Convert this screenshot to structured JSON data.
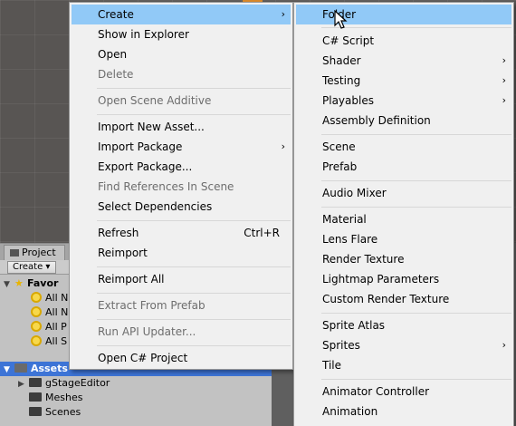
{
  "project_panel": {
    "tab_label": "Project",
    "create_label": "Create ▾",
    "favorites_label": "Favor",
    "favorite_items": [
      "All N",
      "All N",
      "All P",
      "All S"
    ],
    "assets_label": "Assets",
    "asset_folders": [
      "gStageEditor",
      "Meshes",
      "Scenes"
    ]
  },
  "context_menu": {
    "items": [
      {
        "label": "Create",
        "submenu": true,
        "highlighted": true
      },
      {
        "label": "Show in Explorer"
      },
      {
        "label": "Open"
      },
      {
        "label": "Delete",
        "disabled": true
      },
      {
        "label": "Open Scene Additive",
        "disabled": true
      },
      {
        "label": "Import New Asset..."
      },
      {
        "label": "Import Package",
        "submenu": true
      },
      {
        "label": "Export Package..."
      },
      {
        "label": "Find References In Scene",
        "disabled": true
      },
      {
        "label": "Select Dependencies"
      },
      {
        "label": "Refresh",
        "shortcut": "Ctrl+R"
      },
      {
        "label": "Reimport"
      },
      {
        "label": "Reimport All"
      },
      {
        "label": "Extract From Prefab",
        "disabled": true
      },
      {
        "label": "Run API Updater...",
        "disabled": true
      },
      {
        "label": "Open C# Project"
      }
    ]
  },
  "create_submenu": {
    "items": [
      {
        "label": "Folder",
        "highlighted": true
      },
      {
        "label": "C# Script"
      },
      {
        "label": "Shader",
        "submenu": true
      },
      {
        "label": "Testing",
        "submenu": true
      },
      {
        "label": "Playables",
        "submenu": true
      },
      {
        "label": "Assembly Definition"
      },
      {
        "label": "Scene"
      },
      {
        "label": "Prefab"
      },
      {
        "label": "Audio Mixer"
      },
      {
        "label": "Material"
      },
      {
        "label": "Lens Flare"
      },
      {
        "label": "Render Texture"
      },
      {
        "label": "Lightmap Parameters"
      },
      {
        "label": "Custom Render Texture"
      },
      {
        "label": "Sprite Atlas"
      },
      {
        "label": "Sprites",
        "submenu": true
      },
      {
        "label": "Tile"
      },
      {
        "label": "Animator Controller"
      },
      {
        "label": "Animation"
      }
    ]
  },
  "colors": {
    "highlight": "#91c9f7",
    "selection": "#3d74d6",
    "menu_bg": "#f0f0f0"
  }
}
